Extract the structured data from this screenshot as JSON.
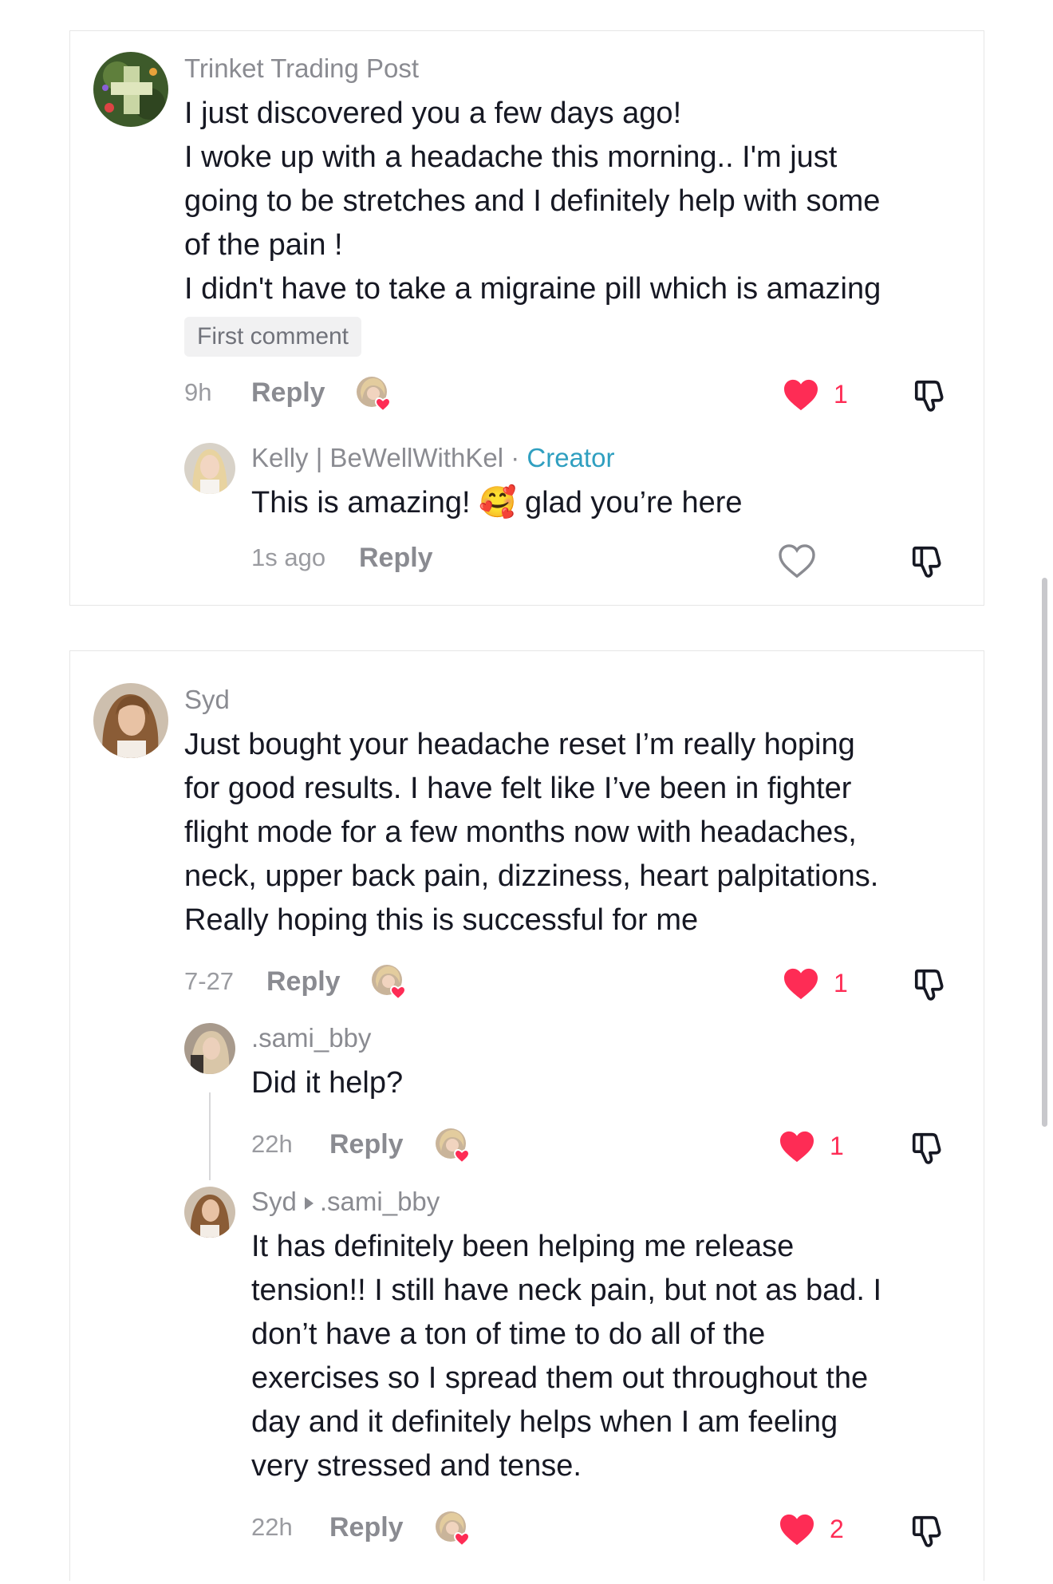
{
  "comments": [
    {
      "author": "Trinket Trading Post",
      "lines": [
        "I just discovered you a few days ago!",
        "I woke up with a headache this morning.. I'm just",
        "going to be stretches and I definitely help with some",
        "of the pain !",
        "I didn't have to take a migraine pill which is amazing"
      ],
      "badge": "First comment",
      "time": "9h",
      "reply_label": "Reply",
      "likes": "1",
      "replies": [
        {
          "author": "Kelly | BeWellWithKel",
          "separator": "·",
          "role": "Creator",
          "text_before_emoji": "This is amazing!",
          "emoji": "🥰",
          "text_after_emoji": "glad you’re here",
          "time": "1s ago",
          "reply_label": "Reply"
        }
      ]
    },
    {
      "author": "Syd",
      "lines": [
        "Just bought your headache reset I’m really hoping",
        "for good results. I have felt like I’ve been in fighter",
        "flight mode for a few months now with headaches,",
        "neck, upper back pain, dizziness, heart palpitations.",
        "Really hoping this is successful for me"
      ],
      "time": "7-27",
      "reply_label": "Reply",
      "likes": "1",
      "replies": [
        {
          "author": ".sami_bby",
          "text": "Did it help?",
          "time": "22h",
          "reply_label": "Reply",
          "likes": "1"
        },
        {
          "author": "Syd",
          "reply_to": ".sami_bby",
          "lines": [
            "It has definitely been helping me release",
            "tension!! I still have neck pain, but not as bad. I",
            "don’t have a ton of time to do all of the",
            "exercises so I spread them out throughout the",
            "day and it definitely helps when I am feeling",
            "very stressed and tense."
          ],
          "time": "22h",
          "reply_label": "Reply",
          "likes": "2"
        }
      ]
    }
  ],
  "colors": {
    "like_red": "#fe2c55",
    "creator_blue": "#2f9fc0",
    "muted_gray": "#8a8b91"
  },
  "icons": [
    "heart-filled-icon",
    "heart-outline-icon",
    "dislike-icon",
    "creator-liked-avatar-icon"
  ]
}
